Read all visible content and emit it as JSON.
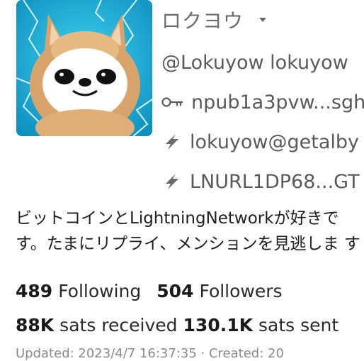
{
  "profile": {
    "display_name": "ロクヨウ",
    "handle": "@Lokuyow lokuyow",
    "npub": "npub1a3pvw...sgh",
    "lud16": "lokuyow@getalby",
    "lnurl": "LNURL1DP68...GT",
    "bio_line1": "ビットコインとLightningNetworkが好きで",
    "bio_line2": "す。たまにリプライ、メンションを見逃しま す"
  },
  "stats": {
    "following_count": "489",
    "following_label": "Following",
    "followers_count": "504",
    "followers_label": "Followers",
    "sats_received_count": "88K",
    "sats_received_label": "sats received",
    "sats_sent_count": "130.1K",
    "sats_sent_label": "sats sent"
  },
  "footer": {
    "updated_text": "Updated: 2023/4/7 16:37:35 · Created: 20"
  },
  "icons": {
    "key": "key-icon",
    "lightning": "lightning-icon",
    "caret": "chevron-down-icon"
  }
}
